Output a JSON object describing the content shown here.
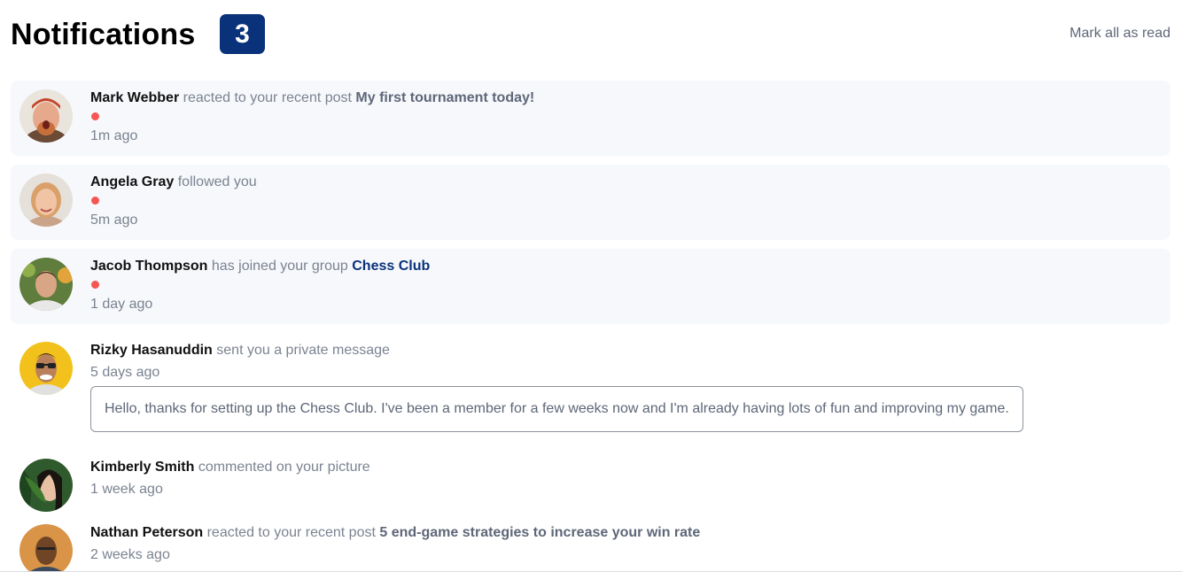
{
  "header": {
    "title": "Notifications",
    "unread_count": "3",
    "mark_all_label": "Mark all as read"
  },
  "colors": {
    "badge": "#0a327b",
    "unread_dot": "#f65552",
    "unread_bg": "#f6f8fb",
    "group_link": "#0a327b"
  },
  "notifications": [
    {
      "name": "Mark Webber",
      "action": "reacted to your recent post",
      "target": "My first tournament today!",
      "unread": true,
      "time": "1m ago"
    },
    {
      "name": "Angela Gray",
      "action": "followed you",
      "unread": true,
      "time": "5m ago"
    },
    {
      "name": "Jacob Thompson",
      "action": "has joined your group",
      "target": "Chess Club",
      "unread": true,
      "time": "1 day ago"
    },
    {
      "name": "Rizky Hasanuddin",
      "action": "sent you a private message",
      "unread": false,
      "time": "5 days ago",
      "message": "Hello, thanks for setting up the Chess Club. I've been a member for a few weeks now and I'm already having lots of fun and improving my game."
    },
    {
      "name": "Kimberly Smith",
      "action": "commented on your picture",
      "unread": false,
      "time": "1 week ago"
    },
    {
      "name": "Nathan Peterson",
      "action": "reacted to your recent post",
      "target": "5 end-game strategies to increase your win rate",
      "unread": false,
      "time": "2 weeks ago"
    }
  ]
}
